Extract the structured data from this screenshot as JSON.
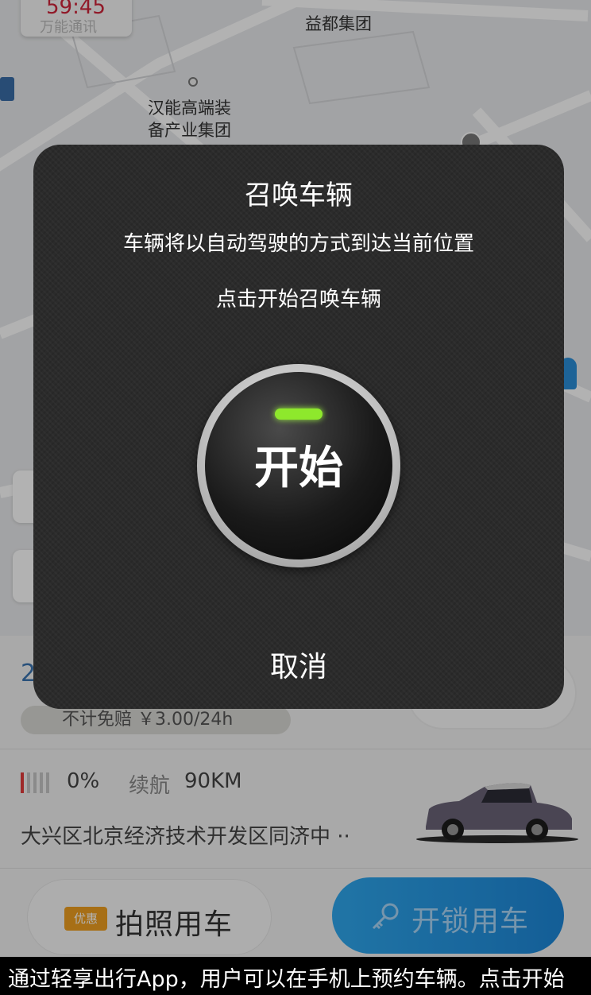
{
  "map": {
    "timer": "59:45",
    "timer_sub": "万能通讯",
    "labels": [
      "益都集团",
      "汉能高端装",
      "备产业集团"
    ]
  },
  "card": {
    "price_partial": "2",
    "insurance": "不计免赔 ￥3.00/24h",
    "battery_pct": "0%",
    "range_label": "续航",
    "range_value": "90KM",
    "address": "大兴区北京经济技术开发区同济中 ··"
  },
  "actions": {
    "coupon": "优惠",
    "photo_label": "拍照用车",
    "unlock_label": "开锁用车"
  },
  "modal": {
    "title": "召唤车辆",
    "desc": "车辆将以自动驾驶的方式到达当前位置",
    "hint": "点击开始召唤车辆",
    "start": "开始",
    "cancel": "取消"
  },
  "caption": "通过轻享出行App，用户可以在手机上预约车辆。点击开始",
  "colors": {
    "accent_blue": "#1d87d8",
    "timer_red": "#d0243a",
    "led_green": "#8ee82c",
    "coupon_orange": "#f0a020"
  }
}
